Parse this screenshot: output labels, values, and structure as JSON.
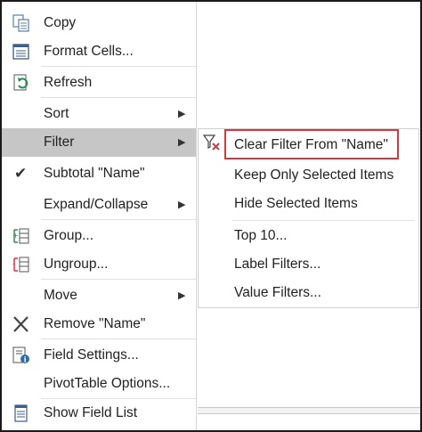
{
  "menu": {
    "items": [
      {
        "label": "Copy",
        "icon": "copy-icon"
      },
      {
        "label": "Format Cells...",
        "icon": "format-cells-icon"
      },
      {
        "label": "Refresh",
        "icon": "refresh-icon"
      },
      {
        "label": "Sort",
        "submenu": true
      },
      {
        "label": "Filter",
        "submenu": true,
        "highlighted": true
      },
      {
        "label": "Subtotal \"Name\"",
        "checked": true
      },
      {
        "label": "Expand/Collapse",
        "submenu": true
      },
      {
        "label": "Group...",
        "icon": "group-icon"
      },
      {
        "label": "Ungroup...",
        "icon": "ungroup-icon"
      },
      {
        "label": "Move",
        "submenu": true
      },
      {
        "label": "Remove \"Name\"",
        "icon": "remove-icon"
      },
      {
        "label": "Field Settings...",
        "icon": "field-settings-icon"
      },
      {
        "label": "PivotTable Options..."
      },
      {
        "label": "Show Field List",
        "icon": "field-list-icon"
      }
    ]
  },
  "submenu": {
    "items": [
      {
        "label": "Clear Filter From \"Name\"",
        "icon": "clear-filter-icon",
        "outlined": true
      },
      {
        "label": "Keep Only Selected Items"
      },
      {
        "label": "Hide Selected Items"
      },
      {
        "label": "Top 10..."
      },
      {
        "label": "Label Filters..."
      },
      {
        "label": "Value Filters..."
      }
    ]
  },
  "colors": {
    "highlight": "#c6c6c6",
    "outline": "#d9363e",
    "icon_green": "#2e8b57",
    "icon_blue": "#2b6cb0",
    "icon_red": "#d9363e"
  }
}
